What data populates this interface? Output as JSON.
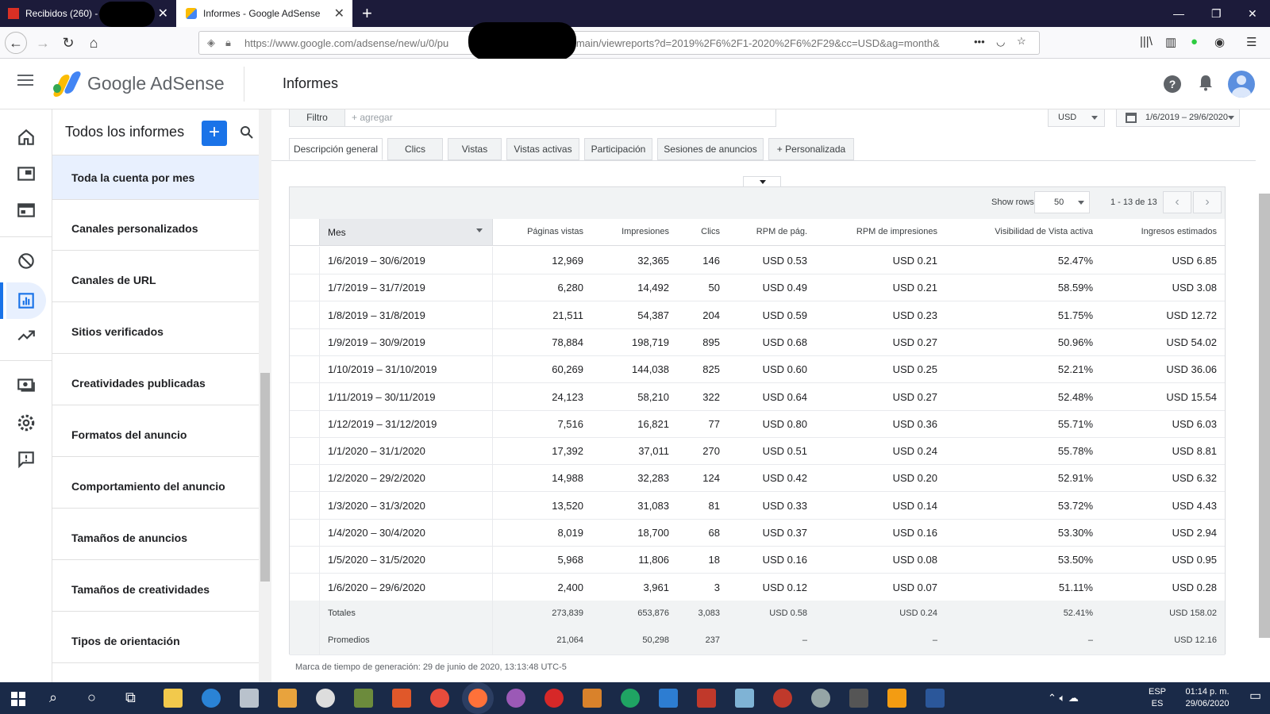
{
  "browser": {
    "tabs": [
      {
        "title": "Recibidos (260) -",
        "active": false
      },
      {
        "title": "Informes - Google AdSense",
        "active": true
      }
    ],
    "url_visible_start": "https://www.google.com/adsense/new/u/0/pu",
    "url_visible_end": "1/main/viewreports?d=2019%2F6%2F1-2020%2F6%2F29&cc=USD&ag=month&"
  },
  "header": {
    "brand": "Google AdSense",
    "page_title": "Informes"
  },
  "rail": {
    "icons": [
      "home-icon",
      "ads-icon",
      "sites-icon",
      "block-icon",
      "reports-icon",
      "optimize-icon",
      "payments-icon",
      "settings-icon",
      "feedback-icon"
    ],
    "active": "reports-icon",
    "accent_color": "#1a73e8"
  },
  "panel": {
    "title": "Todos los informes",
    "add_label": "+",
    "reports": [
      "Toda la cuenta por mes",
      "Canales personalizados",
      "Canales de URL",
      "Sitios verificados",
      "Creatividades publicadas",
      "Formatos del anuncio",
      "Comportamiento del anuncio",
      "Tamaños de anuncios",
      "Tamaños de creatividades",
      "Tipos de orientación"
    ],
    "selected_index": 0
  },
  "toolbar": {
    "filter_label": "Filtro",
    "filter_placeholder": "+ agregar",
    "currency": "USD",
    "date_range": "1/6/2019 – 29/6/2020"
  },
  "tabs": [
    "Descripción general",
    "Clics",
    "Vistas",
    "Vistas activas",
    "Participación",
    "Sesiones de anuncios",
    "+ Personalizada"
  ],
  "pagination": {
    "show_rows_label": "Show rows",
    "rows_value": "50",
    "range": "1 - 13 de 13"
  },
  "table": {
    "columns": [
      "Mes",
      "Páginas vistas",
      "Impresiones",
      "Clics",
      "RPM de pág.",
      "RPM de impresiones",
      "Visibilidad de Vista activa",
      "Ingresos estimados"
    ],
    "rows": [
      [
        "1/6/2019 – 30/6/2019",
        "12,969",
        "32,365",
        "146",
        "USD 0.53",
        "USD 0.21",
        "52.47%",
        "USD 6.85"
      ],
      [
        "1/7/2019 – 31/7/2019",
        "6,280",
        "14,492",
        "50",
        "USD 0.49",
        "USD 0.21",
        "58.59%",
        "USD 3.08"
      ],
      [
        "1/8/2019 – 31/8/2019",
        "21,511",
        "54,387",
        "204",
        "USD 0.59",
        "USD 0.23",
        "51.75%",
        "USD 12.72"
      ],
      [
        "1/9/2019 – 30/9/2019",
        "78,884",
        "198,719",
        "895",
        "USD 0.68",
        "USD 0.27",
        "50.96%",
        "USD 54.02"
      ],
      [
        "1/10/2019 – 31/10/2019",
        "60,269",
        "144,038",
        "825",
        "USD 0.60",
        "USD 0.25",
        "52.21%",
        "USD 36.06"
      ],
      [
        "1/11/2019 – 30/11/2019",
        "24,123",
        "58,210",
        "322",
        "USD 0.64",
        "USD 0.27",
        "52.48%",
        "USD 15.54"
      ],
      [
        "1/12/2019 – 31/12/2019",
        "7,516",
        "16,821",
        "77",
        "USD 0.80",
        "USD 0.36",
        "55.71%",
        "USD 6.03"
      ],
      [
        "1/1/2020 – 31/1/2020",
        "17,392",
        "37,011",
        "270",
        "USD 0.51",
        "USD 0.24",
        "55.78%",
        "USD 8.81"
      ],
      [
        "1/2/2020 – 29/2/2020",
        "14,988",
        "32,283",
        "124",
        "USD 0.42",
        "USD 0.20",
        "52.91%",
        "USD 6.32"
      ],
      [
        "1/3/2020 – 31/3/2020",
        "13,520",
        "31,083",
        "81",
        "USD 0.33",
        "USD 0.14",
        "53.72%",
        "USD 4.43"
      ],
      [
        "1/4/2020 – 30/4/2020",
        "8,019",
        "18,700",
        "68",
        "USD 0.37",
        "USD 0.16",
        "53.30%",
        "USD 2.94"
      ],
      [
        "1/5/2020 – 31/5/2020",
        "5,968",
        "11,806",
        "18",
        "USD 0.16",
        "USD 0.08",
        "53.50%",
        "USD 0.95"
      ],
      [
        "1/6/2020 – 29/6/2020",
        "2,400",
        "3,961",
        "3",
        "USD 0.12",
        "USD 0.07",
        "51.11%",
        "USD 0.28"
      ]
    ],
    "totals": [
      "Totales",
      "273,839",
      "653,876",
      "3,083",
      "USD 0.58",
      "USD 0.24",
      "52.41%",
      "USD 158.02"
    ],
    "averages": [
      "Promedios",
      "21,064",
      "50,298",
      "237",
      "–",
      "–",
      "–",
      "USD 12.16"
    ]
  },
  "timestamp": "Marca de tiempo de generación: 29 de junio de 2020, 13:13:48 UTC-5",
  "taskbar": {
    "language": "ESP",
    "locale": "ES",
    "time": "01:14 p. m.",
    "date": "29/06/2020"
  }
}
